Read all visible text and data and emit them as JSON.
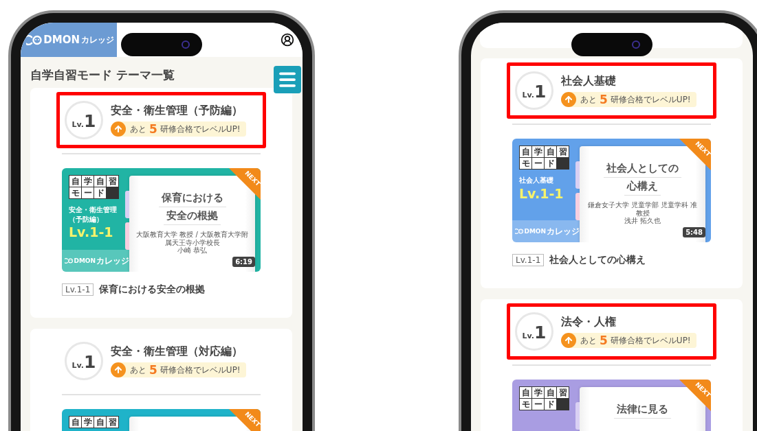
{
  "phones": [
    {
      "header": {
        "logo": "DMON",
        "logo_sub": "カレッジ"
      },
      "page_title": "自学自習モード テーマ一覧",
      "courses": [
        {
          "rank_prefix": "Lv.",
          "rank_number": "1",
          "title": "安全・衛生管理（予防編）",
          "note": "あと**5**研修合格でレベルUP!",
          "highlighted": true,
          "lesson": {
            "color": "#21b4a4",
            "mode_chars": [
              "自",
              "学",
              "自",
              "習",
              "モ",
              "ー",
              "ド"
            ],
            "subject": "安全・衛生管理（予防編）",
            "badge": "Lv.1-1",
            "logo": "DMON",
            "logo_sub": "カレッジ",
            "book_title": [
              "保育における",
              "安全の根拠"
            ],
            "author_lines": [
              "大阪教育大学 教授 / 大阪教育大学附属天王寺小学校長",
              "小崎 恭弘"
            ],
            "duration": "6:19",
            "ribbon": "NEXT",
            "tag": "Lv.1-1",
            "caption": "保育における安全の根拠"
          }
        },
        {
          "rank_prefix": "Lv.",
          "rank_number": "1",
          "title": "安全・衛生管理（対応編）",
          "note": "あと**5**研修合格でレベルUP!",
          "highlighted": false,
          "lesson": {
            "color": "#1fb3c9",
            "mode_chars": [
              "自",
              "学",
              "自",
              "習"
            ],
            "ribbon": "NEXT"
          }
        }
      ]
    },
    {
      "courses": [
        {
          "rank_prefix": "Lv.",
          "rank_number": "1",
          "title": "社会人基礎",
          "note": "あと**5**研修合格でレベルUP!",
          "highlighted": true,
          "lesson": {
            "color": "#62a1ea",
            "mode_chars": [
              "自",
              "学",
              "自",
              "習",
              "モ",
              "ー",
              "ド"
            ],
            "subject": "社会人基礎",
            "badge": "Lv.1-1",
            "logo": "DMON",
            "logo_sub": "カレッジ",
            "book_title": [
              "社会人としての",
              "心構え"
            ],
            "author_lines": [
              "鎌倉女子大学 児童学部 児童学科 准教授",
              "浅井 拓久也"
            ],
            "duration": "5:48",
            "ribbon": "NEXT",
            "tag": "Lv.1-1",
            "caption": "社会人としての心構え"
          }
        },
        {
          "rank_prefix": "Lv.",
          "rank_number": "1",
          "title": "法令・人権",
          "note": "あと**5**研修合格でレベルUP!",
          "highlighted": true,
          "lesson": {
            "color": "#a99de2",
            "mode_chars": [
              "自",
              "学",
              "自",
              "習",
              "モ",
              "ー",
              "ド"
            ],
            "book_title": [
              "法律に見る"
            ],
            "ribbon": "NEXT"
          }
        }
      ]
    }
  ]
}
